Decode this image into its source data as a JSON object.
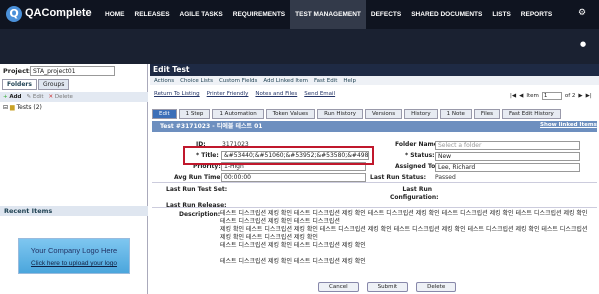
{
  "app": {
    "logo_letter": "Q",
    "brand": "QAComplete"
  },
  "nav": [
    "HOME",
    "RELEASES",
    "AGILE TASKS",
    "REQUIREMENTS",
    "TEST MANAGEMENT",
    "DEFECTS",
    "SHARED DOCUMENTS",
    "LISTS",
    "REPORTS"
  ],
  "nav_active": 4,
  "sidebar": {
    "project_label": "Project:",
    "project_value": "STA_project01",
    "tabs": [
      "Folders",
      "Groups"
    ],
    "toolbar": {
      "add": "Add",
      "edit": "Edit",
      "delete": "Delete"
    },
    "tree_item": "Tests (2)",
    "recent_title": "Recent Items",
    "logo_text": "Your Company Logo Here",
    "logo_link": "Click here to upload your logo"
  },
  "page": {
    "title": "Edit Test"
  },
  "toolbar": [
    "Actions",
    "Choice Lists",
    "Custom Fields",
    "Add Linked Item",
    "Fast Edit",
    "Help"
  ],
  "links": [
    "Return To Listing",
    "Printer Friendly",
    "Notes and Files",
    "Send Email"
  ],
  "pager": {
    "label": "Item",
    "value": "1",
    "of": "of 2"
  },
  "form_tabs": [
    "Edit",
    "1 Step",
    "1 Automation",
    "Token Values",
    "Run History",
    "Versions",
    "History",
    "1 Note",
    "Files",
    "Fast Edit History"
  ],
  "header": {
    "text": "Test #3171023 - 티에블 테스트 01",
    "show_linked": "Show linked Items"
  },
  "fields": {
    "id_label": "ID:",
    "id_value": "3171023",
    "title_label": "* Title:",
    "title_value": "&#53440;&#51060;&#53952;&#53580;&#49828;&#5",
    "priority_label": "Priority:",
    "priority_value": "1-High",
    "avg_label": "Avg Run Time:",
    "avg_value": "00:00:00",
    "lastset_label": "Last Run Test Set:",
    "lastrelease_label": "Last Run Release:",
    "desc_label": "Description:",
    "folder_label": "Folder Name:",
    "folder_placeholder": "Select a folder",
    "status_label": "* Status:",
    "status_value": "New",
    "assigned_label": "Assigned To:",
    "assigned_value": "Lee, Richard",
    "laststatus_label": "Last Run Status:",
    "laststatus_value": "Passed",
    "lastconfig_label": "Last Run Configuration:"
  },
  "description": [
    "테스트 디스크립션 제킹 확인 테스트 디스크립션 제킹 확인 테스트 디스크립션 제킹 확인 테스트 디스크립션 제킹 확인 테스트 디스크립션 제킹 확인 테스트 디스크립션 제킹 확인 테스트 디스크립션",
    "제킹 확인 테스트 디스크립션 제킹 확인 테스트 디스크립션 제킹 확인 테스트 디스크립션 제킹 확인 테스트 디스크립션 제킹 확인 테스트 디스크립션 제킹 확인 테스트 디스크립션 제킹 확인",
    "테스트 디스크립션 제킹 확인 테스트 디스크립션 제킹 확인",
    "",
    "테스트 디스크립션 제킹 확인 테스트 디스크립션 제킹 확인"
  ],
  "buttons": {
    "cancel": "Cancel",
    "submit": "Submit",
    "delete": "Delete"
  }
}
